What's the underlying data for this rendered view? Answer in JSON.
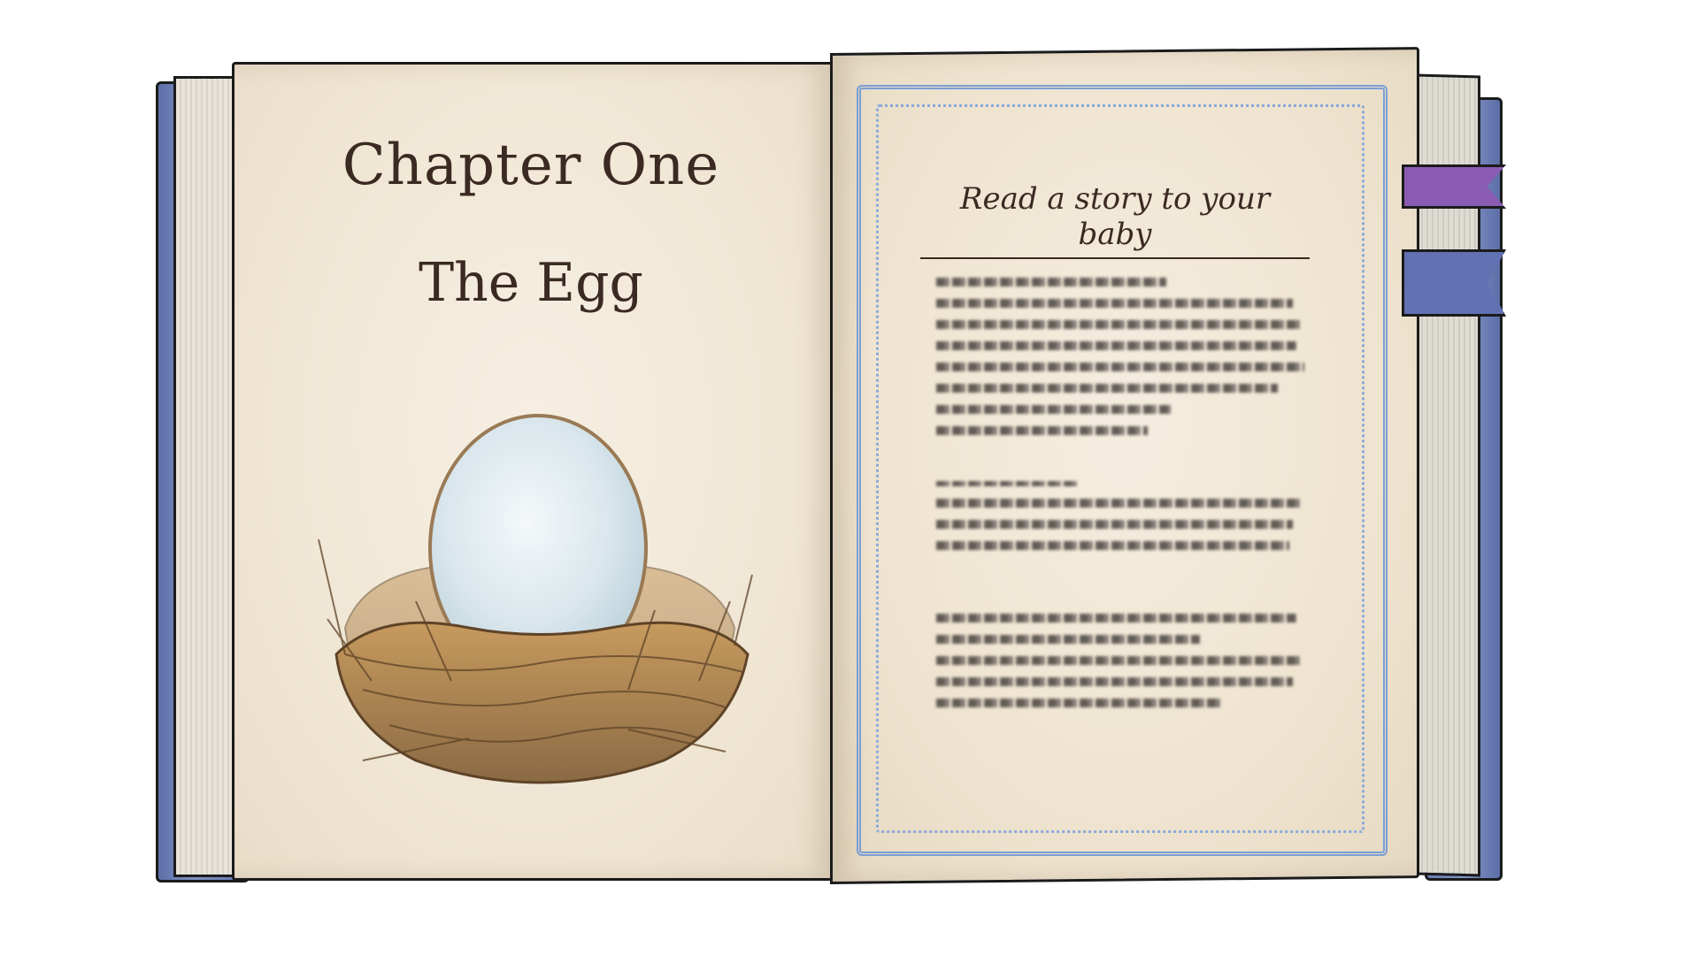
{
  "left_page": {
    "chapter_title": "Chapter One",
    "chapter_subtitle": "The Egg"
  },
  "right_page": {
    "heading": "Read a story to your baby"
  },
  "colors": {
    "cover_blue": "#6a7db7",
    "page_cream": "#f0e6d4",
    "frame_blue": "#7a9ed4",
    "bookmark_purple": "#8a5bb3",
    "bookmark_blue": "#6171b2",
    "ink_brown": "#3a2a22"
  },
  "icons": {
    "illustration": "egg-in-nest-icon",
    "bookmarks": [
      "purple-ribbon-bookmark",
      "blue-ribbon-bookmark"
    ]
  }
}
